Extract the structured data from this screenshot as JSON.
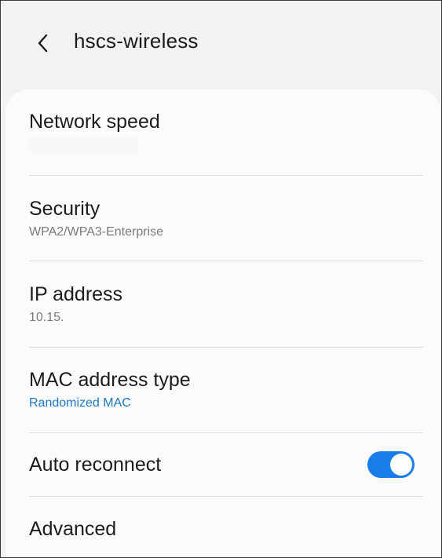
{
  "header": {
    "back_icon": "chevron-left-icon",
    "title": "hscs-wireless"
  },
  "rows": [
    {
      "id": "network-speed",
      "title": "Network speed",
      "subtitle": ""
    },
    {
      "id": "security",
      "title": "Security",
      "subtitle": "WPA2/WPA3-Enterprise"
    },
    {
      "id": "ip-address",
      "title": "IP address",
      "subtitle": "10.15."
    },
    {
      "id": "mac-address-type",
      "title": "MAC address type",
      "subtitle": "Randomized MAC"
    },
    {
      "id": "auto-reconnect",
      "title": "Auto reconnect",
      "toggle_on": true
    },
    {
      "id": "advanced",
      "title": "Advanced"
    }
  ],
  "colors": {
    "accent": "#1b78c7",
    "toggle_on": "#1a7ee8",
    "background": "#f2f2f2",
    "card": "#fbfbfb"
  }
}
